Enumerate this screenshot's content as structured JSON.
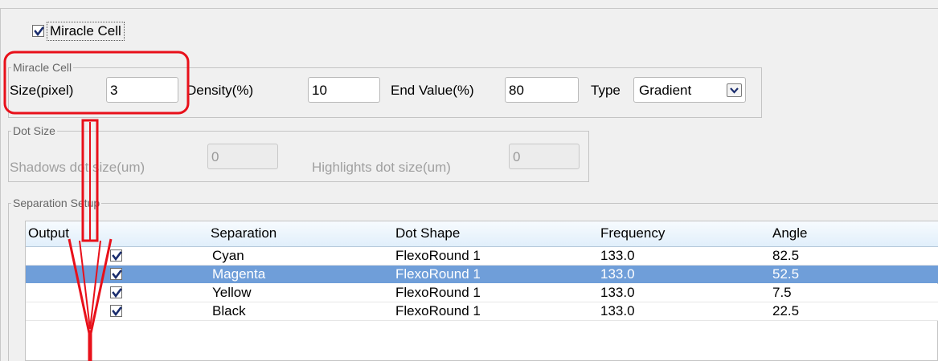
{
  "miracle_checkbox": {
    "label": "Miracle Cell",
    "checked": true
  },
  "miracle_group": {
    "legend": "Miracle Cell",
    "size_label": "Size(pixel)",
    "size_value": "3",
    "density_label": "Density(%)",
    "density_value": "10",
    "end_label": "End Value(%)",
    "end_value": "80",
    "type_label": "Type",
    "type_value": "Gradient"
  },
  "dot_group": {
    "legend": "Dot Size",
    "shadows_label": "Shadows dot size(um)",
    "shadows_value": "0",
    "highlights_label": "Highlights dot size(um)",
    "highlights_value": "0"
  },
  "separation_group": {
    "legend": "Separation Setup",
    "columns": [
      "Output",
      "Separation",
      "Dot Shape",
      "Frequency",
      "Angle"
    ],
    "rows": [
      {
        "output": true,
        "separation": "Cyan",
        "dot_shape": "FlexoRound 1",
        "frequency": "133.0",
        "angle": "82.5",
        "selected": false
      },
      {
        "output": true,
        "separation": "Magenta",
        "dot_shape": "FlexoRound 1",
        "frequency": "133.0",
        "angle": "52.5",
        "selected": true
      },
      {
        "output": true,
        "separation": "Yellow",
        "dot_shape": "FlexoRound 1",
        "frequency": "133.0",
        "angle": "7.5",
        "selected": false
      },
      {
        "output": true,
        "separation": "Black",
        "dot_shape": "FlexoRound 1",
        "frequency": "133.0",
        "angle": "22.5",
        "selected": false
      }
    ]
  },
  "colors": {
    "annotation_red": "#e8101a",
    "selection_blue": "#6f9ed9",
    "header_blue": "#e1effb"
  },
  "icons": {
    "checkbox": "checkmark-icon",
    "dropdown": "chevron-down-icon"
  }
}
